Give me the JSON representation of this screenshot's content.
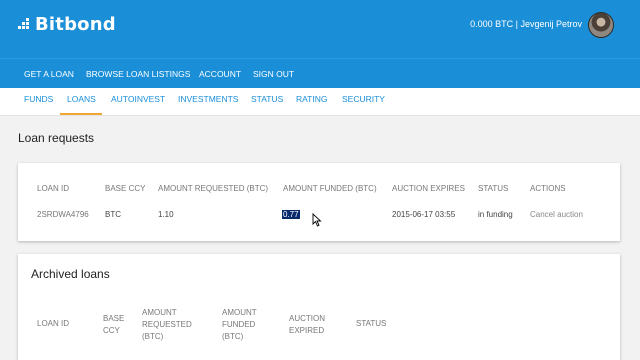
{
  "brand": {
    "name": "Bitbond"
  },
  "header": {
    "user_info": "0.000 BTC | Jevgenij Petrov"
  },
  "main_nav": [
    "GET A LOAN",
    "BROWSE LOAN LISTINGS",
    "ACCOUNT",
    "SIGN OUT"
  ],
  "sub_nav": {
    "items": [
      "FUNDS",
      "LOANS",
      "AUTOINVEST",
      "INVESTMENTS",
      "STATUS",
      "RATING",
      "SECURITY"
    ],
    "active": "LOANS"
  },
  "loan_requests": {
    "title": "Loan requests",
    "headers": [
      "LOAN ID",
      "BASE CCY",
      "AMOUNT REQUESTED (BTC)",
      "AMOUNT FUNDED (BTC)",
      "AUCTION EXPIRES",
      "STATUS",
      "ACTIONS"
    ],
    "row": {
      "loan_id": "2SRDWA4796",
      "base_ccy": "BTC",
      "amount_requested": "1.10",
      "amount_funded": "0.77",
      "auction_expires": "2015-06-17 03:55",
      "status": "in funding",
      "action": "Cancel auction"
    }
  },
  "archived_loans": {
    "title": "Archived loans",
    "headers": {
      "loan_id": "LOAN ID",
      "base_ccy": [
        "BASE",
        "CCY"
      ],
      "amount_requested": [
        "AMOUNT",
        "REQUESTED",
        "(BTC)"
      ],
      "amount_funded": [
        "AMOUNT",
        "FUNDED",
        "(BTC)"
      ],
      "auction_expired": [
        "AUCTION",
        "EXPIRED"
      ],
      "status": "STATUS"
    }
  },
  "colors": {
    "primary": "#1a8fd8",
    "active_tab": "#f0a832",
    "selection": "#0a2a6e"
  }
}
